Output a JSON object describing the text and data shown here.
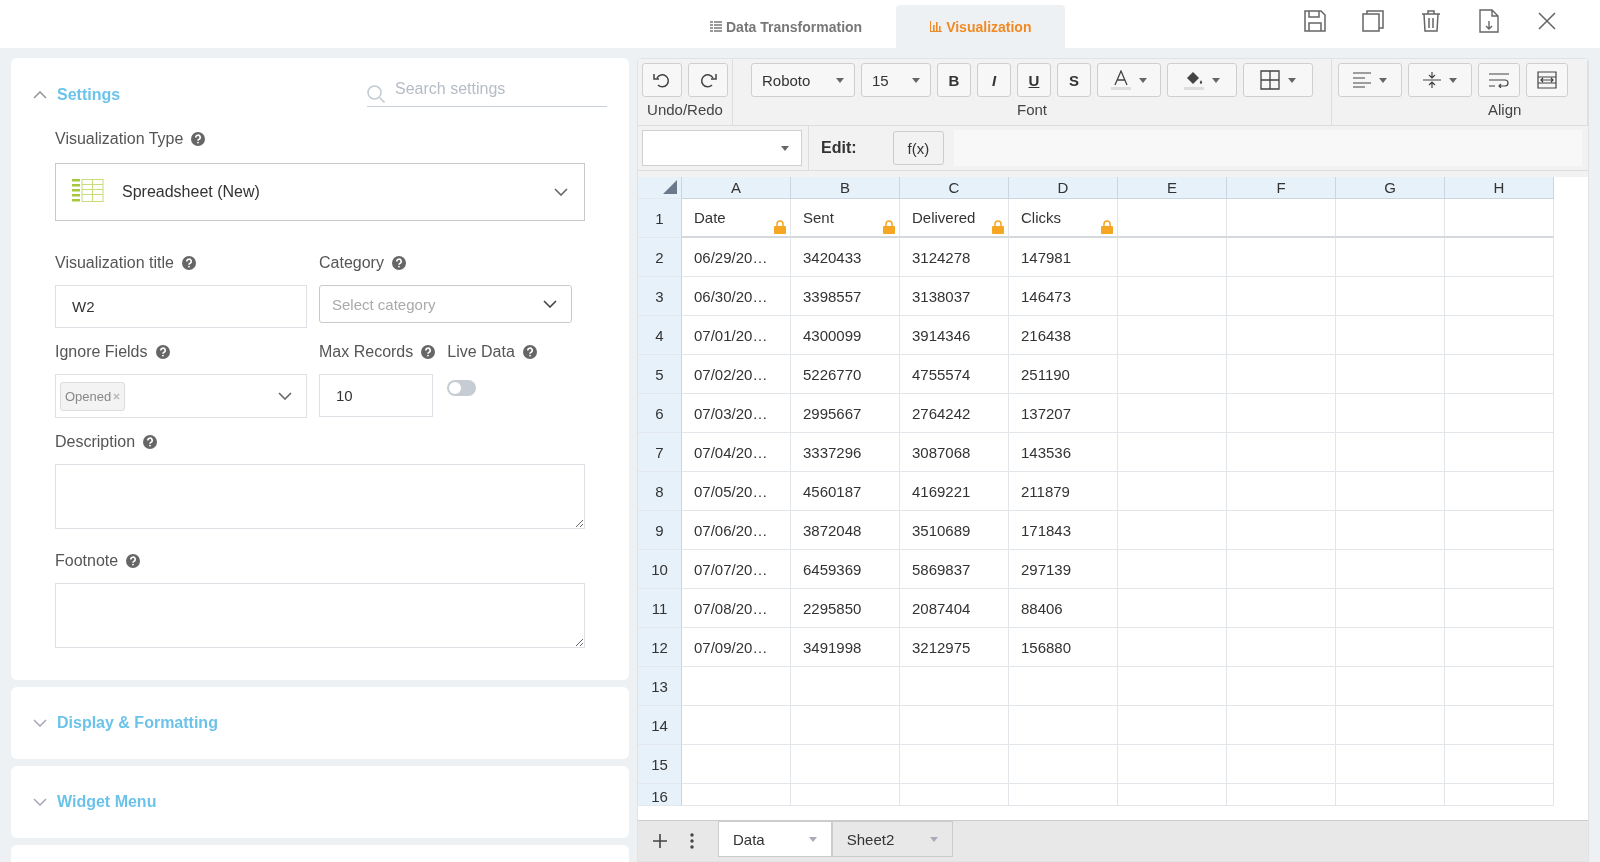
{
  "header": {
    "tabs": [
      {
        "label": "Data Transformation",
        "kind": "table",
        "selected": false
      },
      {
        "label": "Visualization",
        "kind": "chart",
        "selected": true
      }
    ]
  },
  "settings": {
    "title": "Settings",
    "expanded": true,
    "search": {
      "placeholder": "Search settings"
    },
    "visualization_type": {
      "label": "Visualization Type",
      "value": "Spreadsheet (New)"
    },
    "visualization_title": {
      "label": "Visualization title",
      "value": "W2"
    },
    "category": {
      "label": "Category",
      "placeholder": "Select category"
    },
    "ignore_fields": {
      "label": "Ignore Fields",
      "tags": [
        "Opened"
      ]
    },
    "max_records": {
      "label": "Max Records",
      "value": "10"
    },
    "live_data": {
      "label": "Live Data",
      "on": false
    },
    "description": {
      "label": "Description"
    },
    "footnote": {
      "label": "Footnote"
    }
  },
  "sections": [
    {
      "title": "Display & Formatting",
      "expanded": false
    },
    {
      "title": "Widget Menu",
      "expanded": false
    }
  ],
  "toolbar": {
    "groups": [
      "Undo/Redo",
      "Font",
      "Align"
    ],
    "font": "Roboto",
    "size": "15",
    "style_buttons": [
      {
        "label": "B",
        "kind": "bold"
      },
      {
        "label": "I",
        "kind": "italic"
      },
      {
        "label": "U",
        "kind": "underline"
      },
      {
        "label": "S",
        "kind": "strong"
      }
    ]
  },
  "formula_bar": {
    "label": "Edit:",
    "button": "f(x)"
  },
  "sheet": {
    "columns": [
      "A",
      "B",
      "C",
      "D",
      "E",
      "F",
      "G",
      "H"
    ],
    "rows": [
      {
        "number": "1",
        "locked": true,
        "cells": [
          "Date",
          "Sent",
          "Delivered",
          "Clicks"
        ]
      },
      {
        "number": "2",
        "locked": false,
        "cells": [
          "06/29/20…",
          "3420433",
          "3124278",
          "147981"
        ]
      },
      {
        "number": "3",
        "locked": false,
        "cells": [
          "06/30/20…",
          "3398557",
          "3138037",
          "146473"
        ]
      },
      {
        "number": "4",
        "locked": false,
        "cells": [
          "07/01/20…",
          "4300099",
          "3914346",
          "216438"
        ]
      },
      {
        "number": "5",
        "locked": false,
        "cells": [
          "07/02/20…",
          "5226770",
          "4755574",
          "251190"
        ]
      },
      {
        "number": "6",
        "locked": false,
        "cells": [
          "07/03/20…",
          "2995667",
          "2764242",
          "137207"
        ]
      },
      {
        "number": "7",
        "locked": false,
        "cells": [
          "07/04/20…",
          "3337296",
          "3087068",
          "143536"
        ]
      },
      {
        "number": "8",
        "locked": false,
        "cells": [
          "07/05/20…",
          "4560187",
          "4169221",
          "211879"
        ]
      },
      {
        "number": "9",
        "locked": false,
        "cells": [
          "07/06/20…",
          "3872048",
          "3510689",
          "171843"
        ]
      },
      {
        "number": "10",
        "locked": false,
        "cells": [
          "07/07/20…",
          "6459369",
          "5869837",
          "297139"
        ]
      },
      {
        "number": "11",
        "locked": false,
        "cells": [
          "07/08/20…",
          "2295850",
          "2087404",
          "88406"
        ]
      },
      {
        "number": "12",
        "locked": false,
        "cells": [
          "07/09/20…",
          "3491998",
          "3212975",
          "156880"
        ]
      },
      {
        "number": "13",
        "locked": false,
        "cells": []
      },
      {
        "number": "14",
        "locked": false,
        "cells": []
      },
      {
        "number": "15",
        "locked": false,
        "cells": []
      },
      {
        "number": "16",
        "locked": false,
        "cells": []
      }
    ]
  },
  "sheet_tabs": [
    {
      "label": "Data",
      "selected": true
    },
    {
      "label": "Sheet2",
      "selected": false
    }
  ]
}
